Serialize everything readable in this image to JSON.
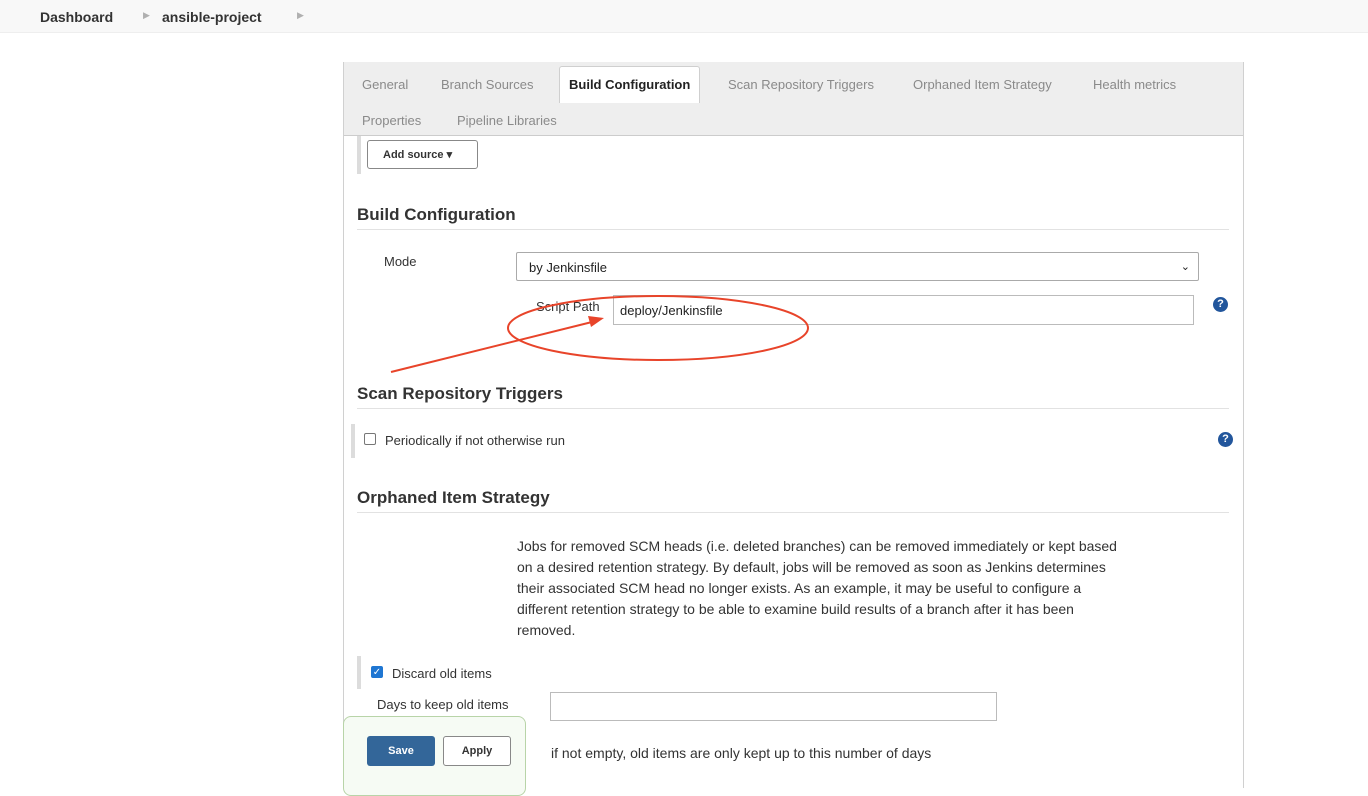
{
  "breadcrumb": {
    "items": [
      "Dashboard",
      "ansible-project"
    ]
  },
  "tabs": [
    "General",
    "Branch Sources",
    "Build Configuration",
    "Scan Repository Triggers",
    "Orphaned Item Strategy",
    "Health metrics",
    "Properties",
    "Pipeline Libraries"
  ],
  "active_tab": "Build Configuration",
  "add_source_label": "Add source ▾",
  "build_config": {
    "title": "Build Configuration",
    "mode_label": "Mode",
    "mode_value": "by Jenkinsfile",
    "script_path_label": "Script Path",
    "script_path_value": "deploy/Jenkinsfile"
  },
  "scan_triggers": {
    "title": "Scan Repository Triggers",
    "periodic_label": "Periodically if not otherwise run",
    "periodic_checked": false
  },
  "orphaned": {
    "title": "Orphaned Item Strategy",
    "description_lines": [
      "Jobs for removed SCM heads (i.e. deleted branches) can be removed immediately or kept based",
      "on a desired retention strategy. By default, jobs will be removed as soon as Jenkins determines",
      "their associated SCM head no longer exists. As an example, it may be useful to configure a",
      "different retention strategy to be able to examine build results of a branch after it has been",
      "removed."
    ],
    "discard_label": "Discard old items",
    "discard_checked": true,
    "days_label": "Days to keep old items",
    "days_value": "",
    "days_hint": "if not empty, old items are only kept up to this number of days"
  },
  "buttons": {
    "save": "Save",
    "apply": "Apply"
  },
  "help_glyph": "?",
  "colors": {
    "annotation": "#e8442a",
    "primary": "#336699",
    "help": "#22569c"
  }
}
